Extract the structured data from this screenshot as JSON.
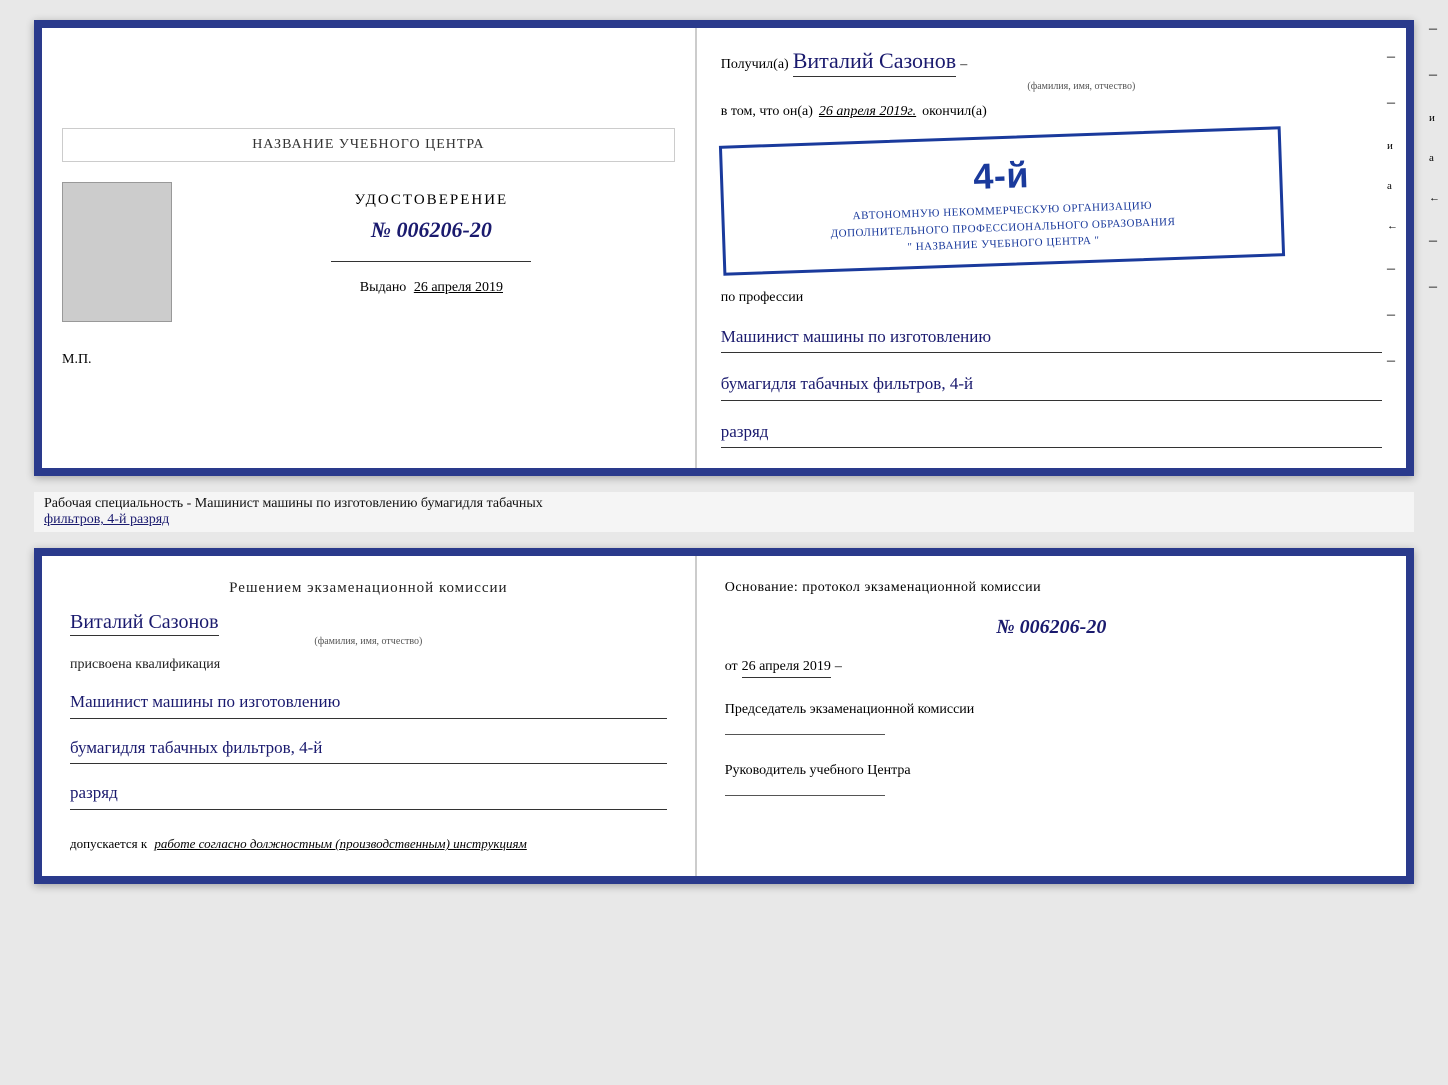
{
  "top_cert": {
    "left_title": "НАЗВАНИЕ УЧЕБНОГО ЦЕНТРА",
    "udost_label": "УДОСТОВЕРЕНИЕ",
    "number": "№ 006206-20",
    "vydano_label": "Выдано",
    "vydano_date": "26 апреля 2019",
    "mp_label": "М.П.",
    "line_placeholder": ""
  },
  "top_right": {
    "poluchil_label": "Получил(а)",
    "recipient_name": "Виталий Сазонов",
    "fio_label": "(фамилия, имя, отчество)",
    "vtom_label": "в том, что он(а)",
    "vtom_date": "26 апреля 2019г.",
    "okonchil_label": "окончил(а)",
    "stamp_line1": "АВТОНОМНУЮ НЕКОММЕРЧЕСКУЮ ОРГАНИЗАЦИЮ",
    "stamp_line2": "ДОПОЛНИТЕЛЬНОГО ПРОФЕССИОНАЛЬНОГО ОБРАЗОВАНИЯ",
    "stamp_line3": "\" НАЗВАНИЕ УЧЕБНОГО ЦЕНТРА \"",
    "stamp_number": "4-й",
    "po_professii_label": "по профессии",
    "profession_line1": "Машинист машины по изготовлению",
    "profession_line2": "бумагидля табачных фильтров, 4-й",
    "profession_line3": "разряд"
  },
  "middle": {
    "text": "Рабочая специальность - Машинист машины по изготовлению бумагидля табачных",
    "text2_underline": "фильтров, 4-й разряд"
  },
  "bottom_left": {
    "decision_label": "Решением  экзаменационной  комиссии",
    "name": "Виталий Сазонов",
    "fio_label": "(фамилия, имя, отчество)",
    "prisvoena_label": "присвоена квалификация",
    "qual_line1": "Машинист машины по изготовлению",
    "qual_line2": "бумагидля табачных фильтров, 4-й",
    "qual_line3": "разряд",
    "dopusk_label": "допускается к",
    "dopusk_italic": "работе согласно должностным (производственным) инструкциям"
  },
  "bottom_right": {
    "osnov_label": "Основание: протокол экзаменационной  комиссии",
    "number": "№  006206-20",
    "ot_label": "от",
    "ot_date": "26 апреля 2019",
    "predsedatel_label": "Председатель экзаменационной комиссии",
    "rukov_label": "Руководитель учебного Центра"
  },
  "side_dashes": [
    "–",
    "–",
    "а",
    "←",
    "–",
    "–",
    "–",
    "–"
  ]
}
